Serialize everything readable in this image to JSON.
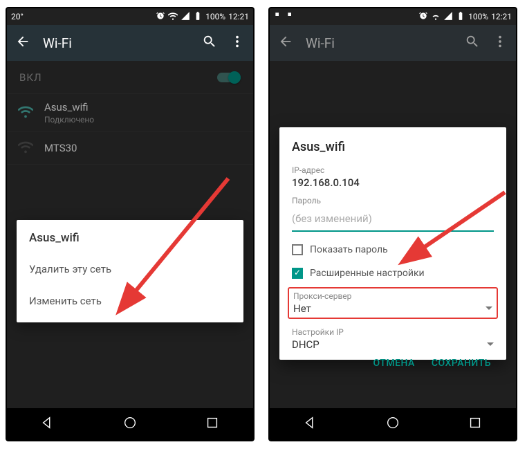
{
  "status": {
    "temp": "20°",
    "battery": "100%",
    "time": "12:21"
  },
  "appbar": {
    "title": "Wi-Fi"
  },
  "toggle": {
    "label": "ВКЛ"
  },
  "networks": [
    {
      "name": "Asus_wifi",
      "sub": "Подключено"
    },
    {
      "name": "MTS30",
      "sub": ""
    }
  ],
  "contextmenu": {
    "title": "Asus_wifi",
    "forget": "Удалить эту сеть",
    "modify": "Изменить сеть"
  },
  "dialog": {
    "title": "Asus_wifi",
    "ip_label": "IP-адрес",
    "ip_value": "192.168.0.104",
    "password_label": "Пароль",
    "password_placeholder": "(без изменений)",
    "show_password": "Показать пароль",
    "advanced": "Расширенные настройки",
    "proxy_label": "Прокси-сервер",
    "proxy_value": "Нет",
    "ipset_label": "Настройки IP",
    "ipset_value": "DHCP",
    "cancel": "ОТМЕНА",
    "save": "СОХРАНИТЬ"
  },
  "colors": {
    "accent": "#009688",
    "highlight": "#e53935"
  }
}
